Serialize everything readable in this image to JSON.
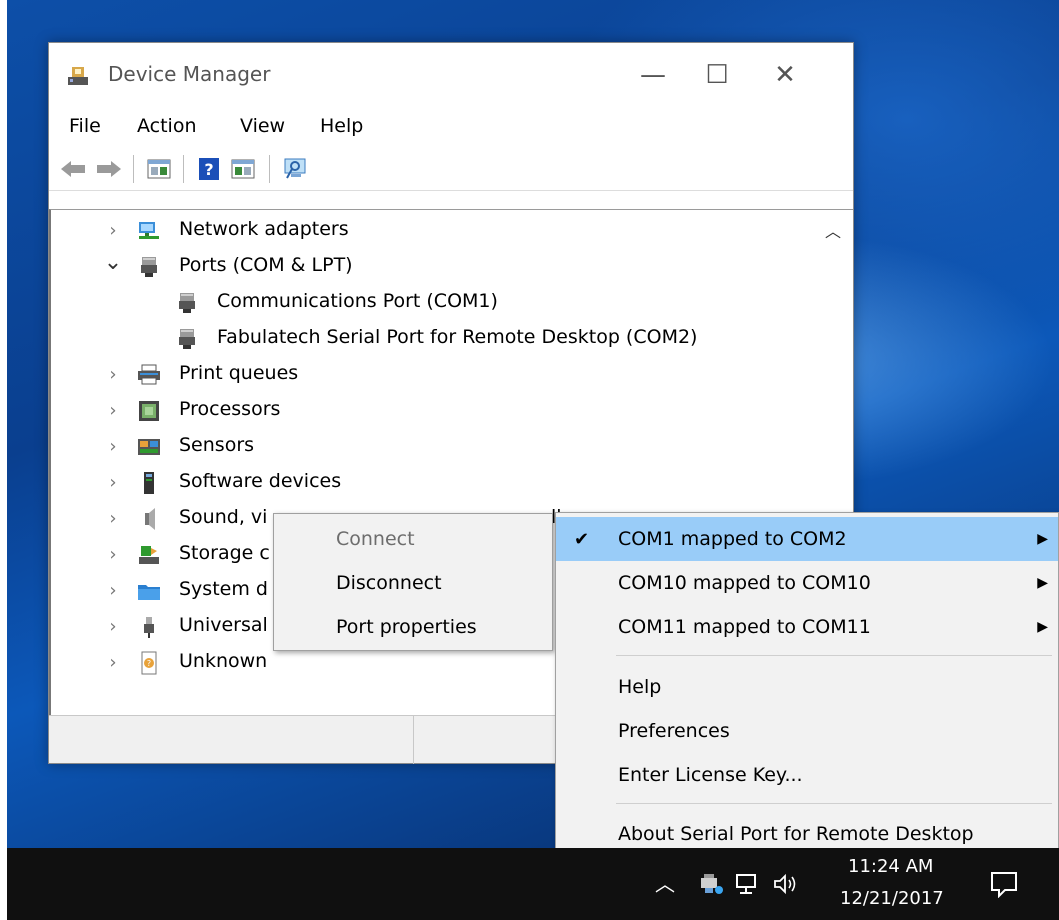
{
  "window": {
    "title": "Device Manager",
    "controls": {
      "minimize": "—",
      "maximize": "☐",
      "close": "✕"
    }
  },
  "menubar": [
    "File",
    "Action",
    "View",
    "Help"
  ],
  "tree": [
    {
      "label": "Network adapters",
      "expanded": false,
      "icon": "network-adapter-icon",
      "level": 0
    },
    {
      "label": "Ports (COM & LPT)",
      "expanded": true,
      "icon": "port-icon",
      "level": 0
    },
    {
      "label": "Communications Port (COM1)",
      "icon": "port-icon",
      "level": 1
    },
    {
      "label": "Fabulatech Serial Port for Remote Desktop (COM2)",
      "icon": "port-icon",
      "level": 1
    },
    {
      "label": "Print queues",
      "expanded": false,
      "icon": "printer-icon",
      "level": 0
    },
    {
      "label": "Processors",
      "expanded": false,
      "icon": "processor-icon",
      "level": 0
    },
    {
      "label": "Sensors",
      "expanded": false,
      "icon": "sensor-icon",
      "level": 0
    },
    {
      "label": "Software devices",
      "expanded": false,
      "icon": "software-device-icon",
      "level": 0
    },
    {
      "label": "Sound, vi",
      "expanded": false,
      "icon": "speaker-icon",
      "level": 0
    },
    {
      "label": "Storage c",
      "expanded": false,
      "icon": "storage-icon",
      "level": 0
    },
    {
      "label": "System d",
      "expanded": false,
      "icon": "system-folder-icon",
      "level": 0
    },
    {
      "label": "Universal",
      "expanded": false,
      "icon": "usb-icon",
      "level": 0
    },
    {
      "label": "Unknown",
      "expanded": false,
      "icon": "unknown-device-icon",
      "level": 0
    }
  ],
  "sound_row_tail": "ll",
  "context_menu_port": {
    "items": [
      {
        "label": "Connect",
        "disabled": true
      },
      {
        "label": "Disconnect",
        "disabled": false
      },
      {
        "label": "Port properties",
        "disabled": false
      }
    ]
  },
  "context_menu_tray": {
    "mappings": [
      {
        "label": "COM1 mapped to COM2",
        "checked": true,
        "highlighted": true
      },
      {
        "label": "COM10 mapped to COM10",
        "checked": false
      },
      {
        "label": "COM11 mapped to COM11",
        "checked": false
      }
    ],
    "actions": [
      "Help",
      "Preferences",
      "Enter License Key..."
    ],
    "about": "About Serial Port for Remote Desktop",
    "check_glyph": "✔",
    "arrow_glyph": "▶"
  },
  "taskbar": {
    "time": "11:24 AM",
    "date": "12/21/2017"
  },
  "colors": {
    "highlight": "#99ccf8",
    "menu_bg": "#f2f2f2",
    "taskbar": "#101010"
  }
}
